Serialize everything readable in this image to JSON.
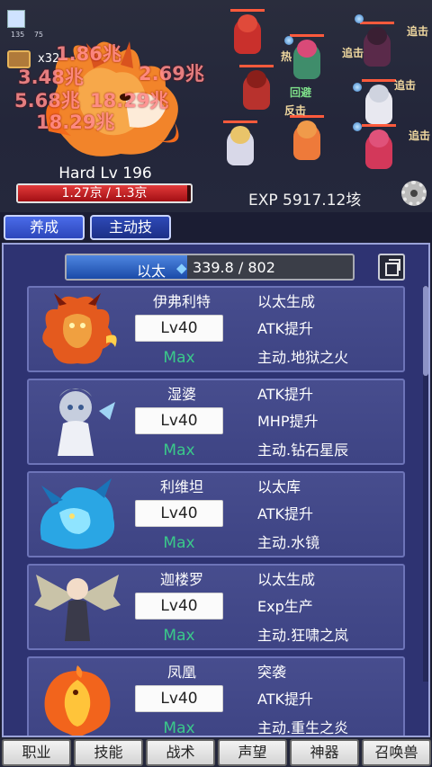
{
  "battle": {
    "portrait_counts": [
      "135",
      "75"
    ],
    "chest_count": "x32",
    "damage_numbers": [
      "1.86兆",
      "3.48兆",
      "2.69兆",
      "5.68兆",
      "18.29兆",
      "18.29兆"
    ],
    "boss_label": "Hard Lv 196",
    "boss_hp": {
      "text": "1.27京 / 1.3京",
      "fraction": 0.98
    },
    "hero_labels": [
      "热",
      "回避",
      "反击",
      "追击",
      "追击",
      "追击",
      "追击"
    ],
    "exp_text": "EXP 5917.12垓"
  },
  "tabs": [
    {
      "label": "养成",
      "active": true
    },
    {
      "label": "主动技",
      "active": false
    }
  ],
  "ether": {
    "label": "以太",
    "icon": "ether-diamond-icon",
    "value": "339.8 / 802",
    "fraction": 0.42
  },
  "monsters": [
    {
      "name": "伊弗利特",
      "level": "Lv40",
      "max": "Max",
      "skills": [
        "以太生成",
        "ATK提升",
        "主动.地狱之火"
      ]
    },
    {
      "name": "湿婆",
      "level": "Lv40",
      "max": "Max",
      "skills": [
        "ATK提升",
        "MHP提升",
        "主动.钻石星辰"
      ]
    },
    {
      "name": "利维坦",
      "level": "Lv40",
      "max": "Max",
      "skills": [
        "以太库",
        "ATK提升",
        "主动.水镜"
      ]
    },
    {
      "name": "迦楼罗",
      "level": "Lv40",
      "max": "Max",
      "skills": [
        "以太生成",
        "Exp生产",
        "主动.狂啸之岚"
      ]
    },
    {
      "name": "凤凰",
      "level": "Lv40",
      "max": "Max",
      "skills": [
        "突袭",
        "ATK提升",
        "主动.重生之炎"
      ]
    }
  ],
  "bottom_nav": [
    "职业",
    "技能",
    "战术",
    "声望",
    "神器",
    "召唤兽"
  ],
  "colors": {
    "accent": "#2c46bb",
    "panel": "#2e3372",
    "max_green": "#3ac98a",
    "hp_red": "#c01c22"
  }
}
